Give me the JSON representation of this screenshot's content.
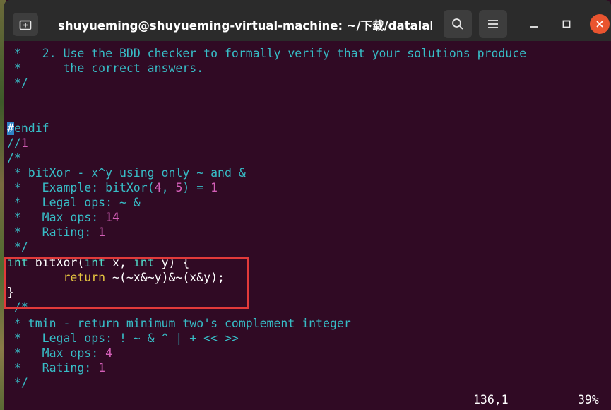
{
  "window": {
    "title": "shuyueming@shuyueming-virtual-machine: ~/下载/datalab-h...",
    "icons": {
      "new_tab": "new-tab-icon",
      "search": "search-icon",
      "menu": "hamburger-menu-icon",
      "minimize": "minimize-icon",
      "maximize": "maximize-icon",
      "close": "close-icon"
    },
    "close_color": "#e9542f"
  },
  "editor": {
    "l1_star": " *",
    "l1_text": "   2. Use the BDD checker to formally verify that your solutions produce",
    "l2_star": " *",
    "l2_text": "      the correct answers.",
    "l3": " */",
    "l6_cursor": "#",
    "l6_rest": "endif",
    "l7_slash": "//",
    "l7_num": "1",
    "l8": "/*",
    "l9": " * bitXor - x^y using only ~ and &",
    "l10_a": " *   Example: bitXor(",
    "l10_b": "4",
    "l10_c": ", ",
    "l10_d": "5",
    "l10_e": ") = ",
    "l10_f": "1",
    "l11": " *   Legal ops: ~ &",
    "l12_a": " *   Max ops: ",
    "l12_b": "14",
    "l13_a": " *   Rating: ",
    "l13_b": "1",
    "l14": " */",
    "l15_int1": "int",
    "l15_mid1": " bitXor(",
    "l15_int2": "int",
    "l15_mid2": " x, ",
    "l15_int3": "int",
    "l15_end": " y) {",
    "l16_indent": "        ",
    "l16_ret": "return",
    "l16_expr": " ~(~x&~y)&~(x&y);",
    "l17": "}",
    "l18": " /*",
    "l19": " * tmin - return minimum two's complement integer",
    "l20": " *   Legal ops: ! ~ & ^ | + << >>",
    "l21_a": " *   Max ops: ",
    "l21_b": "4",
    "l22_a": " *   Rating: ",
    "l22_b": "1",
    "l23": " */"
  },
  "status": {
    "position": "136,1",
    "percent": "39%"
  },
  "colors": {
    "background": "#300a24",
    "comment": "#37bdc7",
    "number": "#d35fb7",
    "keyword": "#4fd7c6",
    "return": "#e5c540",
    "highlight_border": "#e23a3a"
  }
}
